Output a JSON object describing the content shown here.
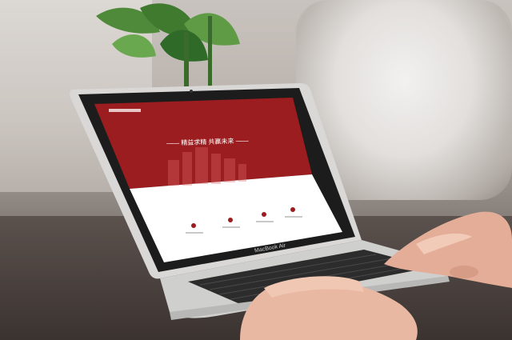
{
  "screen": {
    "site_header": "",
    "hero_title": "——  精益求精  共赢未来  ——",
    "hero_subtitle": "",
    "features": [
      {
        "label": "",
        "desc": ""
      },
      {
        "label": "",
        "desc": ""
      },
      {
        "label": "",
        "desc": ""
      },
      {
        "label": "",
        "desc": ""
      }
    ],
    "brand_badge": "MacBook Air"
  },
  "colors": {
    "brand_red": "#9b1d1f",
    "screen_white": "#ffffff"
  }
}
